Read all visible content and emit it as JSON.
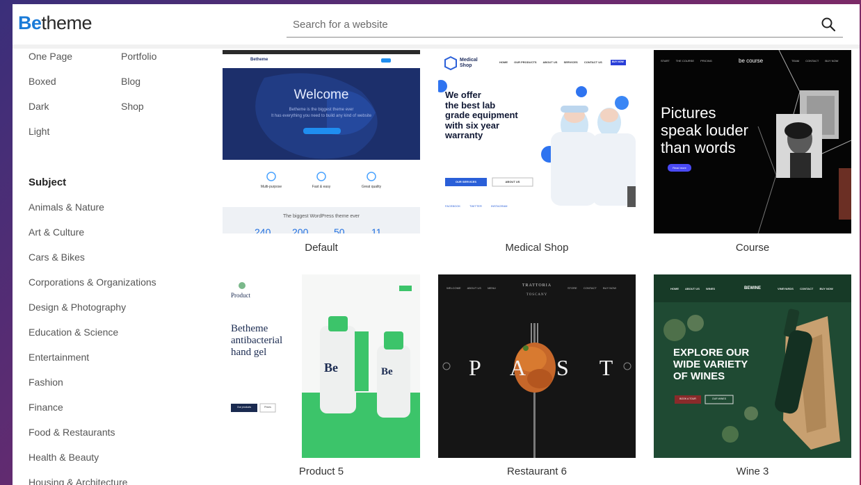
{
  "header": {
    "logo_be": "Be",
    "logo_rest": "theme",
    "search_placeholder": "Search for a website"
  },
  "style_options": [
    "One Page",
    "Portfolio",
    "Boxed",
    "Blog",
    "Dark",
    "Shop",
    "Light"
  ],
  "subject": {
    "heading": "Subject",
    "items": [
      "Animals & Nature",
      "Art & Culture",
      "Cars & Bikes",
      "Corporations & Organizations",
      "Design & Photography",
      "Education & Science",
      "Entertainment",
      "Fashion",
      "Finance",
      "Food & Restaurants",
      "Health & Beauty",
      "Housing & Architecture"
    ]
  },
  "cards": [
    {
      "name": "Default",
      "thumb": {
        "brand": "Betheme",
        "welcome": "Welcome",
        "tagline1": "Betheme is the biggest theme ever",
        "tagline2": "It has everything you need to build any kind of website",
        "features": [
          "Multi-purpose",
          "Fast & easy",
          "Great quality"
        ],
        "bottom_text": "The biggest WordPress theme ever",
        "stats": [
          "240",
          "200",
          "50",
          "11"
        ]
      }
    },
    {
      "name": "Medical Shop",
      "thumb": {
        "brand1": "Medical",
        "brand2": "Shop",
        "nav": [
          "HOME",
          "OUR PRODUCTS",
          "ABOUT US",
          "SERVICES",
          "CONTACT US"
        ],
        "buy": "BUY NOW",
        "headline": [
          "We offer",
          "the best lab",
          "grade equipment",
          "with six year",
          "warranty"
        ],
        "btn1": "OUR SERVICES",
        "btn2": "ABOUT US",
        "social": [
          "FACEBOOK",
          "TWITTER",
          "INSTAGRAM"
        ]
      }
    },
    {
      "name": "Course",
      "thumb": {
        "nav": [
          "START",
          "THE COURSE",
          "PRICING"
        ],
        "brand": "be course",
        "nav_right": [
          "TEAM",
          "CONTACT",
          "BUY NOW"
        ],
        "headline": [
          "Pictures",
          "speak louder",
          "than words"
        ],
        "btn": "Read more"
      }
    },
    {
      "name": "Product 5",
      "thumb": {
        "brand": "Product",
        "headline": [
          "Betheme",
          "antibacterial",
          "hand gel"
        ],
        "cta": "Our products",
        "cta2": "Prices",
        "bottle": "Be"
      }
    },
    {
      "name": "Restaurant 6",
      "thumb": {
        "nav": [
          "WELCOME",
          "ABOUT US",
          "MENU",
          "STORE",
          "CONTACT",
          "BUY NOW"
        ],
        "brand": "TRATTORIA",
        "brand_sub": "TOSCANY",
        "word": "PASTA"
      }
    },
    {
      "name": "Wine 3",
      "thumb": {
        "nav": [
          "HOME",
          "ABOUT US",
          "WINES",
          "VINEYARDS",
          "CONTACT",
          "BUY NOW"
        ],
        "brand": "BEWINE",
        "headline": [
          "EXPLORE OUR",
          "WIDE VARIETY",
          "OF WINES"
        ],
        "btn1": "BOOK A TOUR",
        "btn2": "OUR WINES"
      }
    }
  ],
  "colors": {
    "brand_blue": "#1a7bd8",
    "default_blue": "#1c2f6b",
    "medical_blue": "#1a5fd8",
    "product_green": "#3cc46a",
    "wine_green": "#1f4a33"
  }
}
